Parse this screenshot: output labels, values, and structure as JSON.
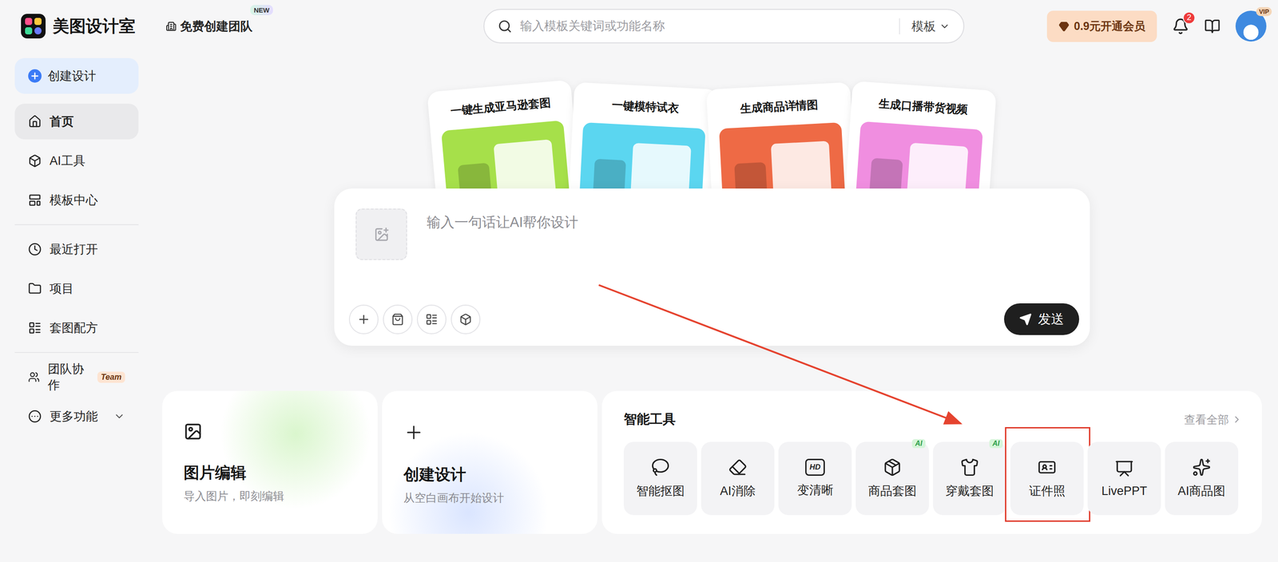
{
  "header": {
    "logo": "美图设计室",
    "team": {
      "label": "免费创建团队",
      "badge": "NEW"
    },
    "search": {
      "placeholder": "输入模板关键词或功能名称",
      "scope": "模板"
    },
    "member": "0.9元开通会员",
    "notifications": "2",
    "avatar_badge": "VIP"
  },
  "sidebar": {
    "create": "创建设计",
    "groups": [
      [
        {
          "label": "首页",
          "selected": true
        },
        {
          "label": "AI工具",
          "selected": false
        },
        {
          "label": "模板中心",
          "selected": false
        }
      ],
      [
        {
          "label": "最近打开",
          "selected": false
        },
        {
          "label": "项目",
          "selected": false
        },
        {
          "label": "套图配方",
          "selected": false
        }
      ],
      [
        {
          "label": "团队协作",
          "selected": false,
          "tag": "Team"
        },
        {
          "label": "更多功能",
          "selected": false,
          "expanded": false
        }
      ]
    ]
  },
  "hero_cards": [
    {
      "title": "一键生成亚马逊套图",
      "color": "#a6e04a"
    },
    {
      "title": "一键模特试衣",
      "color": "#5bd6f0"
    },
    {
      "title": "生成商品详情图",
      "color": "#ee6a45"
    },
    {
      "title": "生成口播带货视频",
      "color": "#f08ee0"
    }
  ],
  "composer": {
    "placeholder": "输入一句话让AI帮你设计",
    "send": "发送"
  },
  "quick_cards": [
    {
      "title": "图片编辑",
      "subtitle": "导入图片，即刻编辑"
    },
    {
      "title": "创建设计",
      "subtitle": "从空白画布开始设计"
    }
  ],
  "tools": {
    "title": "智能工具",
    "more": "查看全部",
    "items": [
      {
        "label": "智能抠图",
        "highlighted": false
      },
      {
        "label": "AI消除",
        "highlighted": false
      },
      {
        "label": "变清晰",
        "icon_text": "HD",
        "highlighted": false
      },
      {
        "label": "商品套图",
        "badge": "AI",
        "highlighted": false
      },
      {
        "label": "穿戴套图",
        "badge": "AI",
        "highlighted": false
      },
      {
        "label": "证件照",
        "highlighted": true
      },
      {
        "label": "LivePPT",
        "highlighted": false
      },
      {
        "label": "AI商品图",
        "highlighted": false
      }
    ]
  }
}
